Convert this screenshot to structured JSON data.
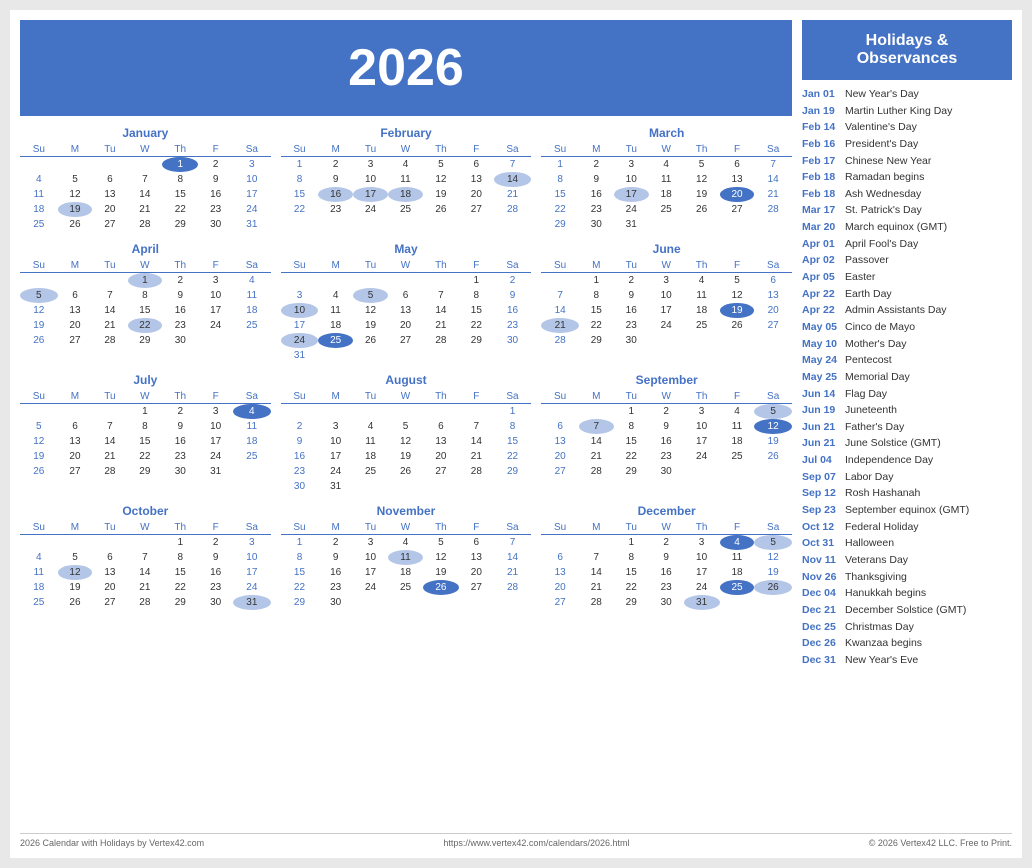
{
  "year": "2026",
  "header": {
    "title": "2026"
  },
  "sidebar": {
    "title": "Holidays &\nObservances",
    "holidays": [
      {
        "date": "Jan 01",
        "name": "New Year's Day"
      },
      {
        "date": "Jan 19",
        "name": "Martin Luther King Day"
      },
      {
        "date": "Feb 14",
        "name": "Valentine's Day"
      },
      {
        "date": "Feb 16",
        "name": "President's Day"
      },
      {
        "date": "Feb 17",
        "name": "Chinese New Year"
      },
      {
        "date": "Feb 18",
        "name": "Ramadan begins"
      },
      {
        "date": "Feb 18",
        "name": "Ash Wednesday"
      },
      {
        "date": "Mar 17",
        "name": "St. Patrick's Day"
      },
      {
        "date": "Mar 20",
        "name": "March equinox (GMT)"
      },
      {
        "date": "Apr 01",
        "name": "April Fool's Day"
      },
      {
        "date": "Apr 02",
        "name": "Passover"
      },
      {
        "date": "Apr 05",
        "name": "Easter"
      },
      {
        "date": "Apr 22",
        "name": "Earth Day"
      },
      {
        "date": "Apr 22",
        "name": "Admin Assistants Day"
      },
      {
        "date": "May 05",
        "name": "Cinco de Mayo"
      },
      {
        "date": "May 10",
        "name": "Mother's Day"
      },
      {
        "date": "May 24",
        "name": "Pentecost"
      },
      {
        "date": "May 25",
        "name": "Memorial Day"
      },
      {
        "date": "Jun 14",
        "name": "Flag Day"
      },
      {
        "date": "Jun 19",
        "name": "Juneteenth"
      },
      {
        "date": "Jun 21",
        "name": "Father's Day"
      },
      {
        "date": "Jun 21",
        "name": "June Solstice (GMT)"
      },
      {
        "date": "Jul 04",
        "name": "Independence Day"
      },
      {
        "date": "Sep 07",
        "name": "Labor Day"
      },
      {
        "date": "Sep 12",
        "name": "Rosh Hashanah"
      },
      {
        "date": "Sep 23",
        "name": "September equinox (GMT)"
      },
      {
        "date": "Oct 12",
        "name": "Federal Holiday"
      },
      {
        "date": "Oct 31",
        "name": "Halloween"
      },
      {
        "date": "Nov 11",
        "name": "Veterans Day"
      },
      {
        "date": "Nov 26",
        "name": "Thanksgiving"
      },
      {
        "date": "Dec 04",
        "name": "Hanukkah begins"
      },
      {
        "date": "Dec 21",
        "name": "December Solstice (GMT)"
      },
      {
        "date": "Dec 25",
        "name": "Christmas Day"
      },
      {
        "date": "Dec 26",
        "name": "Kwanzaa begins"
      },
      {
        "date": "Dec 31",
        "name": "New Year's Eve"
      }
    ]
  },
  "footer": {
    "left": "2026 Calendar with Holidays by Vertex42.com",
    "center": "https://www.vertex42.com/calendars/2026.html",
    "right": "© 2026 Vertex42 LLC. Free to Print."
  },
  "months": [
    {
      "name": "January",
      "weeks": [
        [
          "",
          "",
          "",
          "",
          "1",
          "2",
          "3"
        ],
        [
          "4",
          "5",
          "6",
          "7",
          "8",
          "9",
          "10"
        ],
        [
          "11",
          "12",
          "13",
          "14",
          "15",
          "16",
          "17"
        ],
        [
          "18",
          "19",
          "20",
          "21",
          "22",
          "23",
          "24"
        ],
        [
          "25",
          "26",
          "27",
          "28",
          "29",
          "30",
          "31"
        ]
      ],
      "highlights": {
        "1": "highlight",
        "19": "highlight-light"
      }
    },
    {
      "name": "February",
      "weeks": [
        [
          "1",
          "2",
          "3",
          "4",
          "5",
          "6",
          "7"
        ],
        [
          "8",
          "9",
          "10",
          "11",
          "12",
          "13",
          "14"
        ],
        [
          "15",
          "16",
          "17",
          "18",
          "19",
          "20",
          "21"
        ],
        [
          "22",
          "23",
          "24",
          "25",
          "26",
          "27",
          "28"
        ]
      ],
      "highlights": {
        "14": "highlight-light",
        "16": "highlight-light",
        "17": "highlight-light",
        "18": "highlight-light"
      }
    },
    {
      "name": "March",
      "weeks": [
        [
          "1",
          "2",
          "3",
          "4",
          "5",
          "6",
          "7"
        ],
        [
          "8",
          "9",
          "10",
          "11",
          "12",
          "13",
          "14"
        ],
        [
          "15",
          "16",
          "17",
          "18",
          "19",
          "20",
          "21"
        ],
        [
          "22",
          "23",
          "24",
          "25",
          "26",
          "27",
          "28"
        ],
        [
          "29",
          "30",
          "31"
        ]
      ],
      "highlights": {
        "17": "highlight-light",
        "20": "highlight"
      }
    },
    {
      "name": "April",
      "weeks": [
        [
          "",
          "",
          "",
          "1",
          "2",
          "3",
          "4"
        ],
        [
          "5",
          "6",
          "7",
          "8",
          "9",
          "10",
          "11"
        ],
        [
          "12",
          "13",
          "14",
          "15",
          "16",
          "17",
          "18"
        ],
        [
          "19",
          "20",
          "21",
          "22",
          "23",
          "24",
          "25"
        ],
        [
          "26",
          "27",
          "28",
          "29",
          "30"
        ]
      ],
      "highlights": {
        "1": "highlight-light",
        "5": "highlight-light",
        "22": "highlight-light"
      }
    },
    {
      "name": "May",
      "weeks": [
        [
          "",
          "",
          "",
          "",
          "",
          "1",
          "2"
        ],
        [
          "3",
          "4",
          "5",
          "6",
          "7",
          "8",
          "9"
        ],
        [
          "10",
          "11",
          "12",
          "13",
          "14",
          "15",
          "16"
        ],
        [
          "17",
          "18",
          "19",
          "20",
          "21",
          "22",
          "23"
        ],
        [
          "24",
          "25",
          "26",
          "27",
          "28",
          "29",
          "30"
        ],
        [
          "31"
        ]
      ],
      "highlights": {
        "5": "highlight-light",
        "10": "highlight-light",
        "24": "highlight-light",
        "25": "highlight"
      }
    },
    {
      "name": "June",
      "weeks": [
        [
          "",
          "1",
          "2",
          "3",
          "4",
          "5",
          "6"
        ],
        [
          "7",
          "8",
          "9",
          "10",
          "11",
          "12",
          "13"
        ],
        [
          "14",
          "15",
          "16",
          "17",
          "18",
          "19",
          "20"
        ],
        [
          "21",
          "22",
          "23",
          "24",
          "25",
          "26",
          "27"
        ],
        [
          "28",
          "29",
          "30"
        ]
      ],
      "highlights": {
        "19": "highlight",
        "21": "highlight-light"
      }
    },
    {
      "name": "July",
      "weeks": [
        [
          "",
          "",
          "",
          "1",
          "2",
          "3",
          "4"
        ],
        [
          "5",
          "6",
          "7",
          "8",
          "9",
          "10",
          "11"
        ],
        [
          "12",
          "13",
          "14",
          "15",
          "16",
          "17",
          "18"
        ],
        [
          "19",
          "20",
          "21",
          "22",
          "23",
          "24",
          "25"
        ],
        [
          "26",
          "27",
          "28",
          "29",
          "30",
          "31"
        ]
      ],
      "highlights": {
        "4": "highlight"
      }
    },
    {
      "name": "August",
      "weeks": [
        [
          "",
          "",
          "",
          "",
          "",
          "",
          "1"
        ],
        [
          "2",
          "3",
          "4",
          "5",
          "6",
          "7",
          "8"
        ],
        [
          "9",
          "10",
          "11",
          "12",
          "13",
          "14",
          "15"
        ],
        [
          "16",
          "17",
          "18",
          "19",
          "20",
          "21",
          "22"
        ],
        [
          "23",
          "24",
          "25",
          "26",
          "27",
          "28",
          "29"
        ],
        [
          "30",
          "31"
        ]
      ],
      "highlights": {}
    },
    {
      "name": "September",
      "weeks": [
        [
          "",
          "",
          "1",
          "2",
          "3",
          "4",
          "5"
        ],
        [
          "6",
          "7",
          "8",
          "9",
          "10",
          "11",
          "12"
        ],
        [
          "13",
          "14",
          "15",
          "16",
          "17",
          "18",
          "19"
        ],
        [
          "20",
          "21",
          "22",
          "23",
          "24",
          "25",
          "26"
        ],
        [
          "27",
          "28",
          "29",
          "30"
        ]
      ],
      "highlights": {
        "5": "highlight-light",
        "7": "highlight-light",
        "12": "highlight"
      }
    },
    {
      "name": "October",
      "weeks": [
        [
          "",
          "",
          "",
          "",
          "1",
          "2",
          "3"
        ],
        [
          "4",
          "5",
          "6",
          "7",
          "8",
          "9",
          "10"
        ],
        [
          "11",
          "12",
          "13",
          "14",
          "15",
          "16",
          "17"
        ],
        [
          "18",
          "19",
          "20",
          "21",
          "22",
          "23",
          "24"
        ],
        [
          "25",
          "26",
          "27",
          "28",
          "29",
          "30",
          "31"
        ]
      ],
      "highlights": {
        "12": "highlight-light",
        "31": "highlight-light"
      }
    },
    {
      "name": "November",
      "weeks": [
        [
          "1",
          "2",
          "3",
          "4",
          "5",
          "6",
          "7"
        ],
        [
          "8",
          "9",
          "10",
          "11",
          "12",
          "13",
          "14"
        ],
        [
          "15",
          "16",
          "17",
          "18",
          "19",
          "20",
          "21"
        ],
        [
          "22",
          "23",
          "24",
          "25",
          "26",
          "27",
          "28"
        ],
        [
          "29",
          "30"
        ]
      ],
      "highlights": {
        "11": "highlight-light",
        "26": "highlight"
      }
    },
    {
      "name": "December",
      "weeks": [
        [
          "",
          "",
          "1",
          "2",
          "3",
          "4",
          "5"
        ],
        [
          "6",
          "7",
          "8",
          "9",
          "10",
          "11",
          "12"
        ],
        [
          "13",
          "14",
          "15",
          "16",
          "17",
          "18",
          "19"
        ],
        [
          "20",
          "21",
          "22",
          "23",
          "24",
          "25",
          "26"
        ],
        [
          "27",
          "28",
          "29",
          "30",
          "31"
        ]
      ],
      "highlights": {
        "4": "highlight",
        "5": "highlight-light",
        "25": "highlight",
        "26": "highlight-light",
        "31": "highlight-light"
      }
    }
  ]
}
